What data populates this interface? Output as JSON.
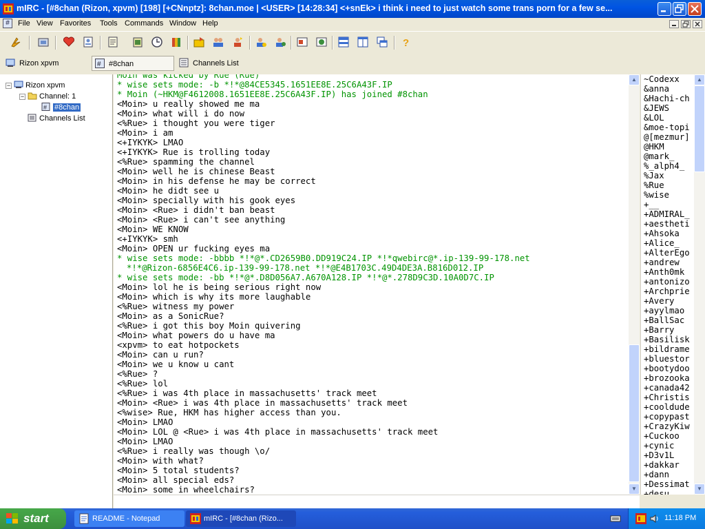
{
  "window": {
    "title": "mIRC - [#8chan (Rizon, xpvm) [198] [+CNnptz]: 8chan.moe  |  <USER> [14:28:34] <+snEk> i think i need to just watch some trans porn for a few se..."
  },
  "menu": [
    "File",
    "View",
    "Favorites",
    "Tools",
    "Commands",
    "Window",
    "Help"
  ],
  "switchbar": {
    "items": [
      {
        "label": "Rizon xpvm",
        "icon": "server-icon"
      },
      {
        "label": "#8chan",
        "icon": "channel-icon"
      },
      {
        "label": "Channels List",
        "icon": "list-icon"
      }
    ]
  },
  "tree": {
    "server": "Rizon xpvm",
    "channels_folder": "Channel: 1",
    "channel": "#8chan",
    "channels_list": "Channels List"
  },
  "chat": {
    "lines": [
      {
        "text": "Moin was kicked by Rue (Rue)",
        "color": "green"
      },
      {
        "text": "* wise sets mode: -b *!*@84CE5345.1651EE8E.25C6A43F.IP",
        "color": "green"
      },
      {
        "text": "* Moin (~HKM@F4612008.1651EE8E.25C6A43F.IP) has joined #8chan",
        "color": "green"
      },
      {
        "text": "<Moin> u really showed me ma"
      },
      {
        "text": "<Moin> what will i do now"
      },
      {
        "text": "<%Rue> i thought you were tiger"
      },
      {
        "text": "<Moin> i am"
      },
      {
        "text": "<+IYKYK> LMAO"
      },
      {
        "text": "<+IYKYK> Rue is trolling today"
      },
      {
        "text": "<%Rue> spamming the channel"
      },
      {
        "text": "<Moin> well he is chinese Beast"
      },
      {
        "text": "<Moin> in his defense he may be correct"
      },
      {
        "text": "<Moin> he didt see u"
      },
      {
        "text": "<Moin> specially with his gook eyes"
      },
      {
        "text": "<Moin> <Rue> i didn't ban beast"
      },
      {
        "text": "<Moin> <Rue> i can't see anything"
      },
      {
        "text": "<Moin> WE KNOW"
      },
      {
        "text": "<+IYKYK> smh"
      },
      {
        "text": "<Moin> OPEN ur fucking eyes ma"
      },
      {
        "text": "* wise sets mode: -bbbb *!*@*.CD2659B0.DD919C24.IP *!*qwebirc@*.ip-139-99-178.net",
        "color": "green"
      },
      {
        "text": "*!*@Rizon-6856E4C6.ip-139-99-178.net *!*@E4B1703C.49D4DE3A.B816D012.IP",
        "color": "green",
        "wrap": true
      },
      {
        "text": "* wise sets mode: -bb *!*@*.D8D056A7.A670A128.IP *!*@*.278D9C3D.10A0D7C.IP",
        "color": "green"
      },
      {
        "text": "<Moin> lol he is being serious right now"
      },
      {
        "text": "<Moin> which is why its more laughable"
      },
      {
        "text": "<%Rue> witness my power"
      },
      {
        "text": "<Moin> as a SonicRue?"
      },
      {
        "text": "<%Rue> i got this boy Moin quivering"
      },
      {
        "text": "<Moin> what powers do u have ma"
      },
      {
        "text": "<xpvm> to eat hotpockets"
      },
      {
        "text": "<Moin> can u run?"
      },
      {
        "text": "<Moin> we u know u cant"
      },
      {
        "text": "<%Rue> ?"
      },
      {
        "text": "<%Rue> lol"
      },
      {
        "text": "<%Rue> i was 4th place in massachusetts' track meet"
      },
      {
        "text": "<Moin> <Rue> i was 4th place in massachusetts' track meet"
      },
      {
        "text": "<%wise> Rue, HKM has higher access than you."
      },
      {
        "text": "<Moin> LMAO"
      },
      {
        "text": "<Moin> LOL @ <Rue> i was 4th place in massachusetts' track meet"
      },
      {
        "text": "<Moin> LMAO"
      },
      {
        "text": "<%Rue> i really was though \\o/"
      },
      {
        "text": "<Moin> with what?"
      },
      {
        "text": "<Moin> 5 total students?"
      },
      {
        "text": "<Moin> all special eds?"
      },
      {
        "text": "<Moin> some in wheelchairs?"
      }
    ]
  },
  "nicklist": [
    "~Codexx",
    "&anna",
    "&Hachi-ch",
    "&JEWS",
    "&LOL",
    "&moe-topi",
    "@[mezmur]",
    "@HKM",
    "@mark_",
    "%_alph4_",
    "%Jax",
    "%Rue",
    "%wise",
    "+__",
    "+ADMIRAL_",
    "+aestheti",
    "+Ahsoka",
    "+Alice_",
    "+AlterEgo",
    "+andrew",
    "+Anth0mk",
    "+antonizo",
    "+Archprie",
    "+Avery",
    "+ayylmao",
    "+BallSac",
    "+Barry",
    "+Basilisk",
    "+bildrame",
    "+bluestor",
    "+bootydoo",
    "+brozooka",
    "+canada42",
    "+Christis",
    "+cooldude",
    "+copypast",
    "+CrazyKiw",
    "+Cuckoo",
    "+cynic",
    "+D3v1L",
    "+dakkar",
    "+dann",
    "+Dessimat",
    "+desu"
  ],
  "taskbar": {
    "start": "start",
    "tasks": [
      {
        "label": "README - Notepad",
        "icon": "notepad-icon"
      },
      {
        "label": "mIRC - [#8chan (Rizo...",
        "icon": "mirc-icon"
      }
    ],
    "clock": "11:18 PM"
  },
  "colors": {
    "titlebar": "#0054e3",
    "green_text": "#009300",
    "selection": "#316ac5",
    "taskbar": "#245edb",
    "start": "#3c8f3d"
  }
}
